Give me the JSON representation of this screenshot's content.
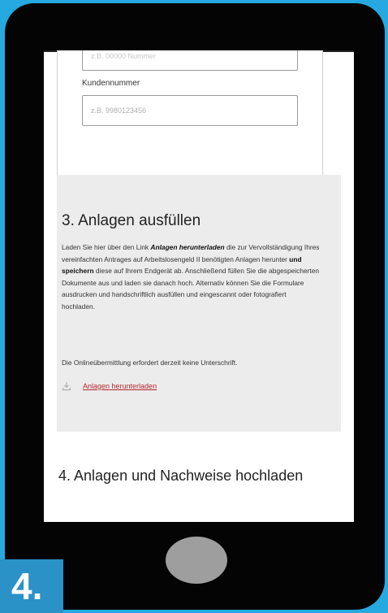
{
  "form": {
    "top_input_placeholder": "z.B. 00000 Nummer",
    "kundennummer_label": "Kundennummer",
    "kundennummer_placeholder": "z.B. 9980123456"
  },
  "section3": {
    "title": "3. Anlagen ausfüllen",
    "text_parts": {
      "p1": "Laden Sie hier über den Link ",
      "link_inline": "Anlagen herunterladen",
      "p2": " die zur Vervollständigung Ihres vereinfachten Antrages auf Arbeitslosengeld II benötigten Anlagen herunter ",
      "und_speichern": "und speichern",
      "p3": " diese auf Ihrem Endgerät ab. Anschließend füllen Sie die abgespeicherten Dokumente aus und laden sie danach hoch. Alternativ können Sie die Formulare ausdrucken und handschriftlich ausfüllen und eingescannt oder fotografiert hochladen."
    },
    "note": "Die Onlineübermittlung erfordert derzeit keine Unterschrift.",
    "download_link": "Anlagen herunterladen"
  },
  "section4": {
    "title": "4. Anlagen und Nachweise hochladen"
  },
  "badge": {
    "step": "4."
  },
  "colors": {
    "background": "#25a9e0",
    "phone": "#040404",
    "link": "#b3262e",
    "section_bg": "#ececec",
    "badge": "#2a92c7"
  },
  "icons": {
    "download": "download-icon"
  }
}
